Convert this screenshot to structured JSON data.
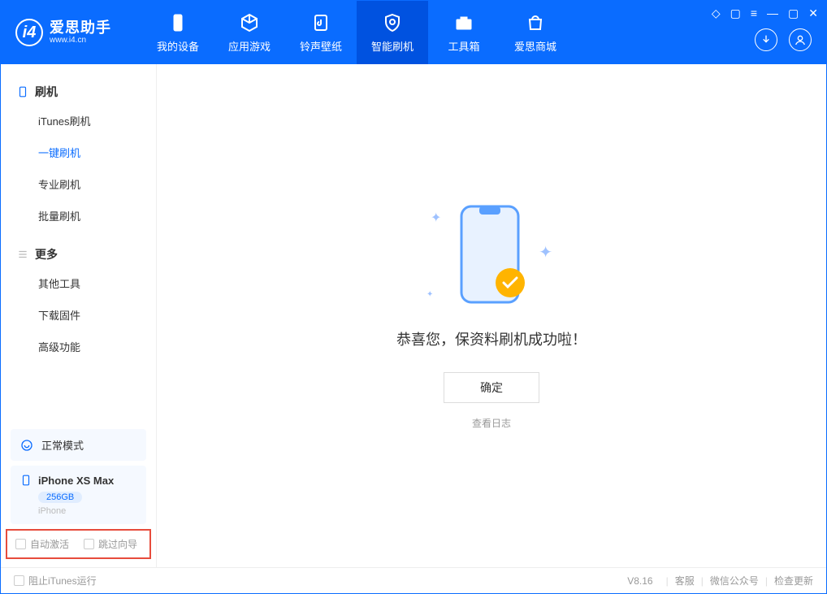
{
  "app": {
    "name_cn": "爱思助手",
    "name_en": "www.i4.cn"
  },
  "nav": {
    "device": "我的设备",
    "apps": "应用游戏",
    "ringtones": "铃声壁纸",
    "flash": "智能刷机",
    "toolbox": "工具箱",
    "store": "爱思商城"
  },
  "sidebar": {
    "section_flash": "刷机",
    "items_flash": {
      "itunes": "iTunes刷机",
      "oneclick": "一键刷机",
      "pro": "专业刷机",
      "batch": "批量刷机"
    },
    "section_more": "更多",
    "items_more": {
      "other": "其他工具",
      "firmware": "下载固件",
      "advanced": "高级功能"
    },
    "mode": "正常模式",
    "device": {
      "name": "iPhone XS Max",
      "storage": "256GB",
      "type": "iPhone"
    },
    "cb_activate": "自动激活",
    "cb_skip": "跳过向导"
  },
  "main": {
    "success": "恭喜您，保资料刷机成功啦！",
    "ok": "确定",
    "log": "查看日志"
  },
  "footer": {
    "block_itunes": "阻止iTunes运行",
    "version": "V8.16",
    "support": "客服",
    "wechat": "微信公众号",
    "update": "检查更新"
  }
}
